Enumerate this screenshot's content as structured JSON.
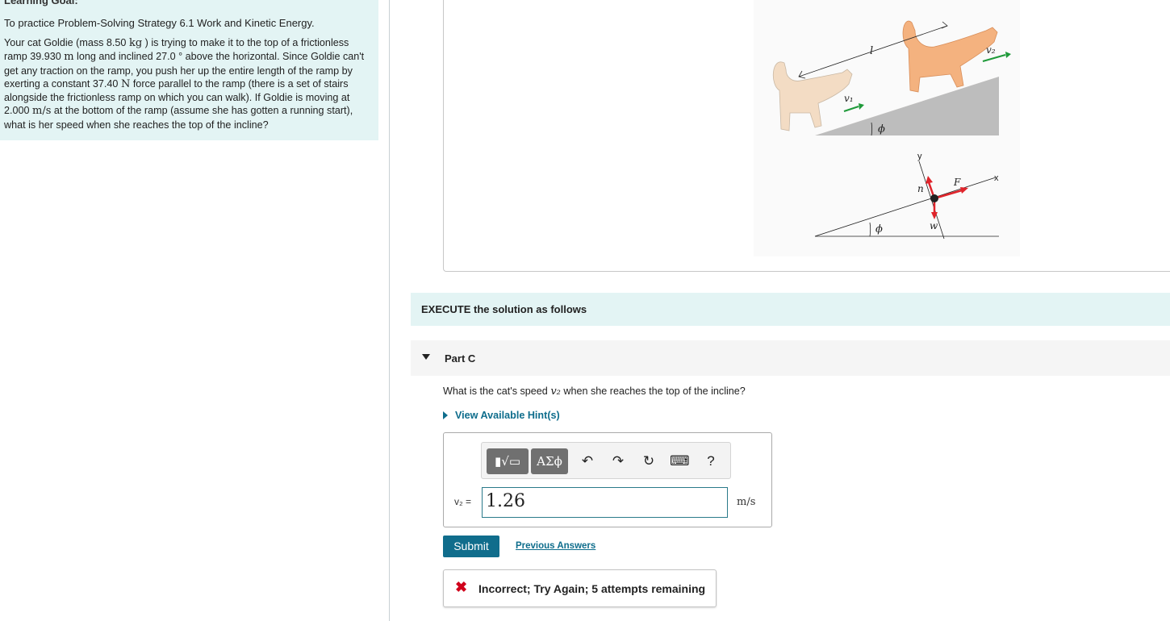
{
  "learning_goal": {
    "heading": "Learning Goal:",
    "text": "To practice Problem-Solving Strategy 6.1 Work and Kinetic Energy."
  },
  "problem": {
    "p1": "Your cat Goldie (mass 8.50",
    "u1": "kg",
    "p2": ") is trying to make it to the top of a frictionless ramp 39.930",
    "u2": "m",
    "p3": "long and inclined 27.0",
    "u3": "°",
    "p4": "above the horizontal. Since Goldie can't get any traction on the ramp, you push her up the entire length of the ramp by exerting a constant 37.40",
    "u4": "N",
    "p5": "force parallel to the ramp (there is a set of stairs alongside the frictionless ramp on which you can walk). If Goldie is moving at 2.000",
    "u5": "m/s",
    "p6": "at the bottom of the ramp (assume she has gotten a running start), what is her speed when she reaches the top of the incline?"
  },
  "figure": {
    "label_l": "l",
    "label_v1": "v₁",
    "label_v2": "v₂",
    "label_phi": "ϕ",
    "label_y": "y",
    "label_x": "x",
    "label_n": "n",
    "label_F": "F",
    "label_w": "w",
    "colors": {
      "cat": "#f4b27f",
      "cat_faded": "#f3dcc4",
      "ramp": "#bdbdbd",
      "force": "#e0242b",
      "velocity": "#1f9a3a"
    }
  },
  "execute": {
    "label": "EXECUTE the solution as follows"
  },
  "part": {
    "title": "Part C",
    "question_a": "What is the cat's speed",
    "question_var": "v₂",
    "question_b": "when she reaches the top of the incline?",
    "hint_label": "View Available Hint(s)"
  },
  "toolbar": {
    "template_label": "▮√▭",
    "greek_label": "ΑΣϕ",
    "undo": "↶",
    "redo": "↷",
    "reset": "↻",
    "keyboard": "⌨",
    "help": "?"
  },
  "answer": {
    "var_label": "v₂ =",
    "value": "1.26",
    "unit": "m/s"
  },
  "actions": {
    "submit": "Submit",
    "previous": "Previous Answers"
  },
  "feedback": {
    "icon": "✖",
    "text": "Incorrect; Try Again; 5 attempts remaining"
  }
}
